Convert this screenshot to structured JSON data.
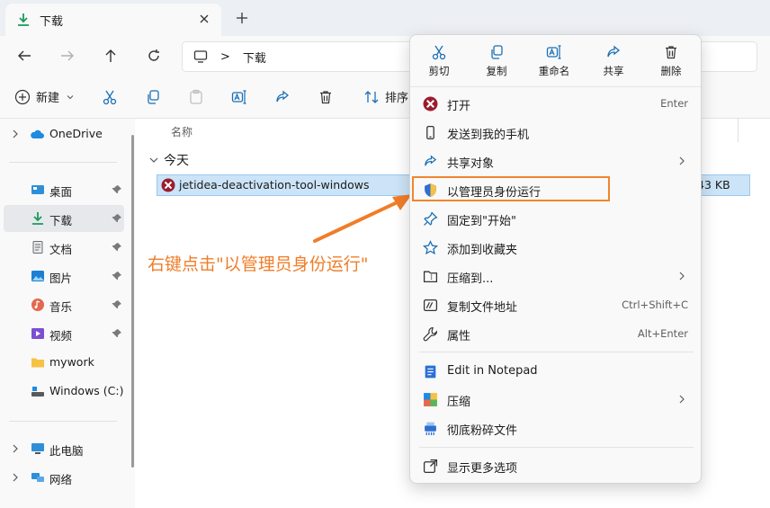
{
  "tab": {
    "title": "下载"
  },
  "address": {
    "separator": ">",
    "crumb": "下载"
  },
  "command_bar": {
    "new_label": "新建",
    "sort_label": "排序"
  },
  "sidebar": {
    "items": [
      {
        "label": "OneDrive"
      },
      {
        "label": "桌面"
      },
      {
        "label": "下载"
      },
      {
        "label": "文档"
      },
      {
        "label": "图片"
      },
      {
        "label": "音乐"
      },
      {
        "label": "视频"
      },
      {
        "label": "mywork"
      },
      {
        "label": "Windows (C:)"
      },
      {
        "label": "此电脑"
      },
      {
        "label": "网络"
      }
    ]
  },
  "content": {
    "column_name": "名称",
    "group_title": "今天",
    "file": {
      "name": "jetidea-deactivation-tool-windows",
      "size": "43 KB"
    }
  },
  "annotation": {
    "text": "右键点击\"以管理员身份运行\""
  },
  "context_menu": {
    "toolbar": [
      {
        "label": "剪切"
      },
      {
        "label": "复制"
      },
      {
        "label": "重命名"
      },
      {
        "label": "共享"
      },
      {
        "label": "删除"
      }
    ],
    "items": [
      {
        "label": "打开",
        "shortcut": "Enter"
      },
      {
        "label": "发送到我的手机",
        "shortcut": ""
      },
      {
        "label": "共享对象",
        "shortcut": ""
      },
      {
        "label": "以管理员身份运行",
        "shortcut": ""
      },
      {
        "label": "固定到\"开始\"",
        "shortcut": ""
      },
      {
        "label": "添加到收藏夹",
        "shortcut": ""
      },
      {
        "label": "压缩到...",
        "shortcut": ""
      },
      {
        "label": "复制文件地址",
        "shortcut": "Ctrl+Shift+C"
      },
      {
        "label": "属性",
        "shortcut": "Alt+Enter"
      },
      {
        "label": "Edit in Notepad",
        "shortcut": ""
      },
      {
        "label": "压缩",
        "shortcut": ""
      },
      {
        "label": "彻底粉碎文件",
        "shortcut": ""
      },
      {
        "label": "显示更多选项",
        "shortcut": ""
      }
    ]
  },
  "colors": {
    "accent": "#0067c0",
    "highlight": "#f0862e",
    "selection": "#cce4f7"
  }
}
